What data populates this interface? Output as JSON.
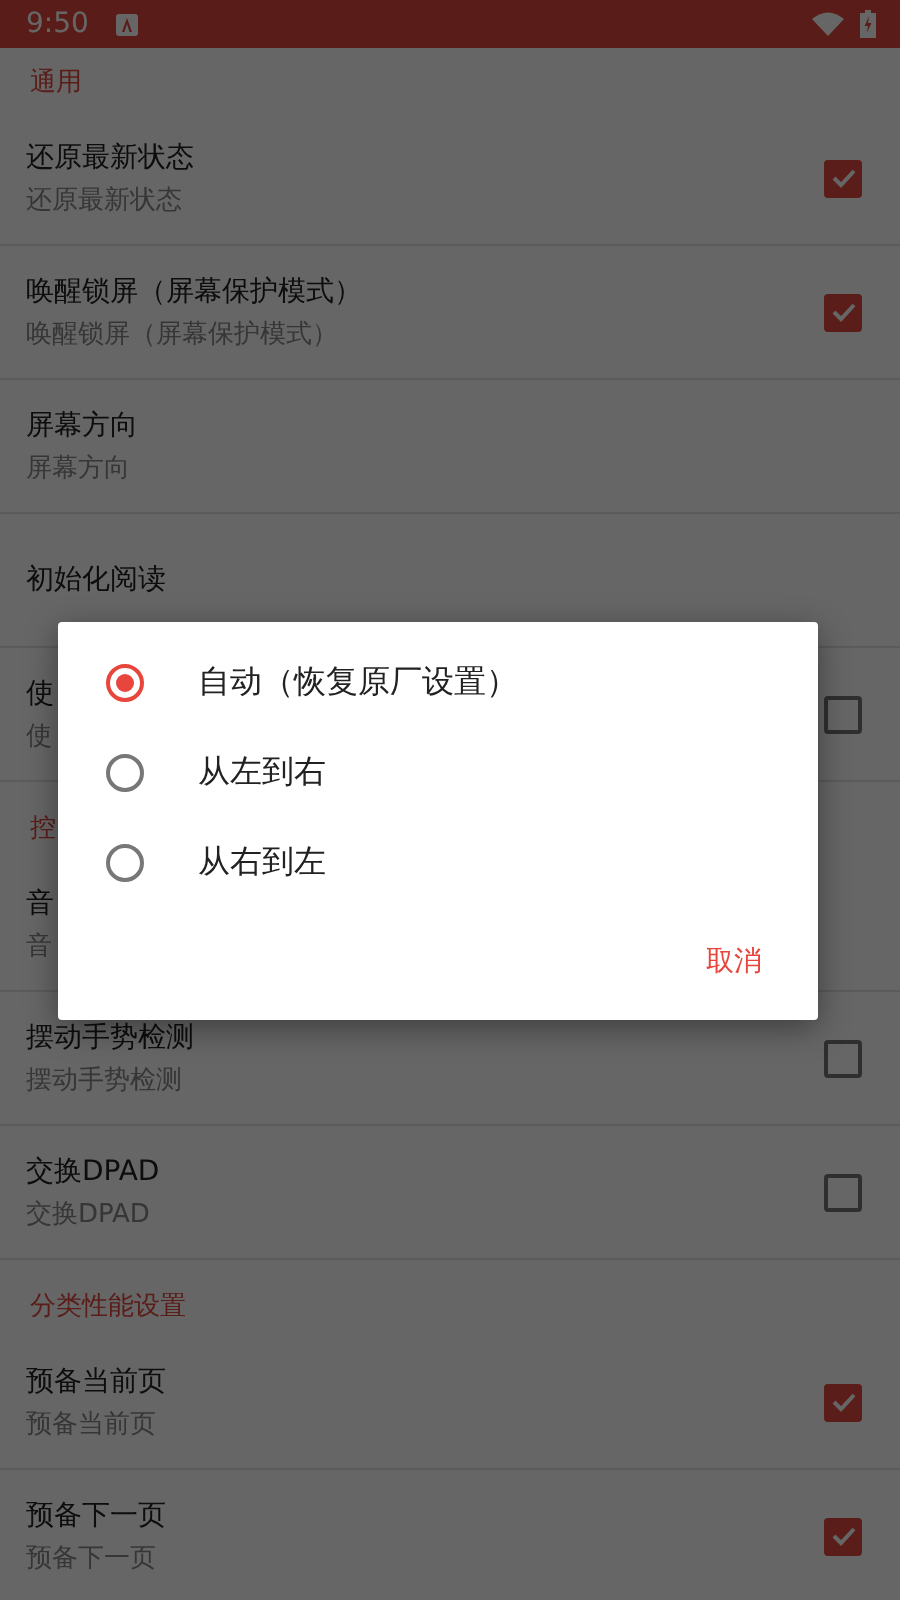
{
  "status_bar": {
    "time": "9:50"
  },
  "settings": [
    {
      "kind": "section",
      "title": "通用"
    },
    {
      "kind": "row",
      "title": "还原最新状态",
      "subtitle": "还原最新状态",
      "checked": true
    },
    {
      "kind": "row",
      "title": "唤醒锁屏（屏幕保护模式）",
      "subtitle": "唤醒锁屏（屏幕保护模式）",
      "checked": true
    },
    {
      "kind": "row",
      "title": "屏幕方向",
      "subtitle": "屏幕方向"
    },
    {
      "kind": "row",
      "title": "初始化阅读"
    },
    {
      "kind": "row",
      "title": "使",
      "subtitle": "使",
      "checked": false
    },
    {
      "kind": "section",
      "title": "控"
    },
    {
      "kind": "row",
      "title": "音",
      "subtitle": "音"
    },
    {
      "kind": "row",
      "title": "摆动手势检测",
      "subtitle": "摆动手势检测",
      "checked": false
    },
    {
      "kind": "row",
      "title": "交换DPAD",
      "subtitle": "交换DPAD",
      "checked": false
    },
    {
      "kind": "section",
      "title": "分类性能设置"
    },
    {
      "kind": "row",
      "title": "预备当前页",
      "subtitle": "预备当前页",
      "checked": true
    },
    {
      "kind": "row",
      "title": "预备下一页",
      "subtitle": "预备下一页",
      "checked": true
    }
  ],
  "dialog": {
    "options": [
      {
        "label": "自动（恢复原厂设置）",
        "selected": true
      },
      {
        "label": "从左到右",
        "selected": false
      },
      {
        "label": "从右到左",
        "selected": false
      }
    ],
    "cancel": "取消"
  }
}
